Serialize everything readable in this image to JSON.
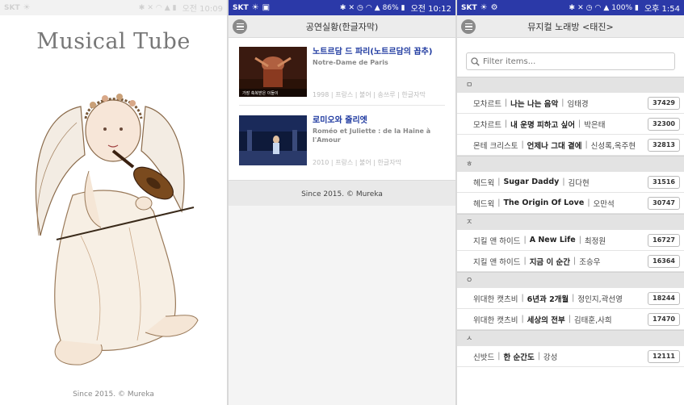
{
  "screen1": {
    "status": {
      "carrier": "SKT",
      "time": "오전 10:09"
    },
    "title": "Musical Tube",
    "footer": "Since 2015. © Mureka"
  },
  "screen2": {
    "status": {
      "carrier": "SKT",
      "battery": "86%",
      "time": "오전 10:12"
    },
    "header_title": "공연실황(한글자막)",
    "items": [
      {
        "title": "노트르담 드 파리(노트르담의 꼽추)",
        "subtitle": "Notre-Dame de Paris",
        "meta": "1998 | 프랑스 | 불어 | 송쓰루 | 한글자막",
        "caption": "가장 축복받은 이들이"
      },
      {
        "title": "로미오와 줄리엣",
        "subtitle": "Roméo et Juliette : de la Haine à l'Amour",
        "meta": "2010 | 프랑스 | 불어 | 한글자막"
      }
    ],
    "footer": "Since 2015. © Mureka"
  },
  "screen3": {
    "status": {
      "carrier": "SKT",
      "battery": "100%",
      "time": "오후 1:54"
    },
    "header_title": "뮤지컬 노래방 <태진>",
    "search_placeholder": "Filter items...",
    "sections": [
      {
        "header": "ㅁ",
        "rows": [
          {
            "musical": "모차르트",
            "song": "나는 나는 음악",
            "singer": "임태경",
            "number": "37429"
          },
          {
            "musical": "모차르트",
            "song": "내 운명 피하고 싶어",
            "singer": "박은태",
            "number": "32300"
          },
          {
            "musical": "몬테 크리스토",
            "song": "언제나 그대 곁에",
            "singer": "신성록,옥주현",
            "number": "32813"
          }
        ]
      },
      {
        "header": "ㅎ",
        "rows": [
          {
            "musical": "헤드윅",
            "song": "Sugar Daddy",
            "singer": "김다현",
            "number": "31516"
          },
          {
            "musical": "헤드윅",
            "song": "The Origin Of Love",
            "singer": "오만석",
            "number": "30747"
          }
        ]
      },
      {
        "header": "ㅈ",
        "rows": [
          {
            "musical": "지킬 앤 하이드",
            "song": "A New Life",
            "singer": "최정원",
            "number": "16727"
          },
          {
            "musical": "지킬 앤 하이드",
            "song": "지금 이 순간",
            "singer": "조승우",
            "number": "16364"
          }
        ]
      },
      {
        "header": "ㅇ",
        "rows": [
          {
            "musical": "위대한 캣츠비",
            "song": "6년과 2개월",
            "singer": "정인지,곽선영",
            "number": "18244"
          },
          {
            "musical": "위대한 캣츠비",
            "song": "세상의 전부",
            "singer": "김태훈,사희",
            "number": "17470"
          }
        ]
      },
      {
        "header": "ㅅ",
        "rows": [
          {
            "musical": "신밧드",
            "song": "한 순간도",
            "singer": "강성",
            "number": "12111"
          }
        ]
      }
    ]
  },
  "colors": {
    "status_blue": "#2b39a8",
    "link_blue": "#1f3aa0"
  }
}
